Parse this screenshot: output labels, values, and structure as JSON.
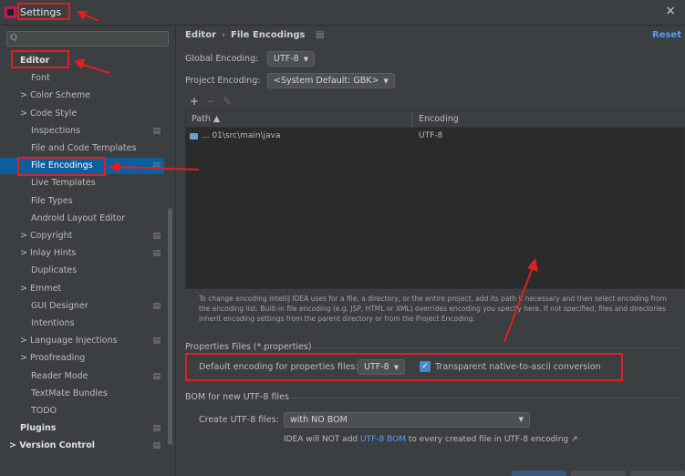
{
  "window": {
    "title": "Settings"
  },
  "search": {
    "placeholder": "Q"
  },
  "tree": [
    {
      "label": "Editor",
      "bold": true,
      "selected": false,
      "mark": ""
    },
    {
      "label": "Font",
      "bold": false,
      "selected": false,
      "mark": ""
    },
    {
      "label": "> Color Scheme",
      "bold": false,
      "selected": false,
      "mark": ""
    },
    {
      "label": "> Code Style",
      "bold": false,
      "selected": false,
      "mark": ""
    },
    {
      "label": "Inspections",
      "bold": false,
      "selected": false,
      "mark": "▤"
    },
    {
      "label": "File and Code Templates",
      "bold": false,
      "selected": false,
      "mark": ""
    },
    {
      "label": "File Encodings",
      "bold": false,
      "selected": true,
      "mark": "▤"
    },
    {
      "label": "Live Templates",
      "bold": false,
      "selected": false,
      "mark": ""
    },
    {
      "label": "File Types",
      "bold": false,
      "selected": false,
      "mark": ""
    },
    {
      "label": "Android Layout Editor",
      "bold": false,
      "selected": false,
      "mark": ""
    },
    {
      "label": "> Copyright",
      "bold": false,
      "selected": false,
      "mark": "▤"
    },
    {
      "label": "> Inlay Hints",
      "bold": false,
      "selected": false,
      "mark": "▤"
    },
    {
      "label": "Duplicates",
      "bold": false,
      "selected": false,
      "mark": ""
    },
    {
      "label": "> Emmet",
      "bold": false,
      "selected": false,
      "mark": ""
    },
    {
      "label": "GUI Designer",
      "bold": false,
      "selected": false,
      "mark": "▤"
    },
    {
      "label": "Intentions",
      "bold": false,
      "selected": false,
      "mark": ""
    },
    {
      "label": "> Language Injections",
      "bold": false,
      "selected": false,
      "mark": "▤"
    },
    {
      "label": "> Proofreading",
      "bold": false,
      "selected": false,
      "mark": ""
    },
    {
      "label": "Reader Mode",
      "bold": false,
      "selected": false,
      "mark": "▤"
    },
    {
      "label": "TextMate Bundles",
      "bold": false,
      "selected": false,
      "mark": ""
    },
    {
      "label": "TODO",
      "bold": false,
      "selected": false,
      "mark": ""
    },
    {
      "label": "Plugins",
      "bold": true,
      "selected": false,
      "mark": "▤"
    },
    {
      "label": "> Version Control",
      "bold": true,
      "selected": false,
      "mark": "▤"
    }
  ],
  "header": {
    "crumb_editor": "Editor",
    "crumb_sep": "›",
    "crumb_page": "File Encodings",
    "crumb_mark": "▤",
    "reset": "Reset"
  },
  "global_encoding": {
    "label": "Global Encoding:",
    "value": "UTF-8"
  },
  "project_encoding": {
    "label": "Project Encoding:",
    "value": "<System Default: GBK>"
  },
  "toolbar": {
    "add": "+",
    "remove": "−",
    "edit": "✎"
  },
  "table": {
    "columns": [
      "Path ▲",
      "Encoding"
    ],
    "rows": [
      {
        "path": "... 01\\src\\main\\java",
        "encoding": "UTF-8"
      }
    ]
  },
  "description": "To change encoding IntelliJ IDEA uses for a file, a directory, or the entire project, add its path if necessary and then select encoding from the encoding list. Built-in file encoding (e.g. JSP, HTML or XML) overrides encoding you specify here. If not specified, files and directories inherit encoding settings from the parent directory or from the Project Encoding.",
  "properties": {
    "section": "Properties Files (*.properties)",
    "label": "Default encoding for properties files:",
    "value": "UTF-8",
    "checkbox_label": "Transparent native-to-ascii conversion",
    "checked": true
  },
  "bom": {
    "section": "BOM for new UTF-8 files",
    "label": "Create UTF-8 files:",
    "value": "with NO BOM",
    "info_pre": "IDEA will NOT add",
    "info_link": "UTF-8 BOM",
    "info_post": "to every created file in UTF-8 encoding ↗"
  },
  "colors": {
    "accent": "#589df6",
    "selection": "#0d5e9c",
    "annotation": "#e02020"
  }
}
